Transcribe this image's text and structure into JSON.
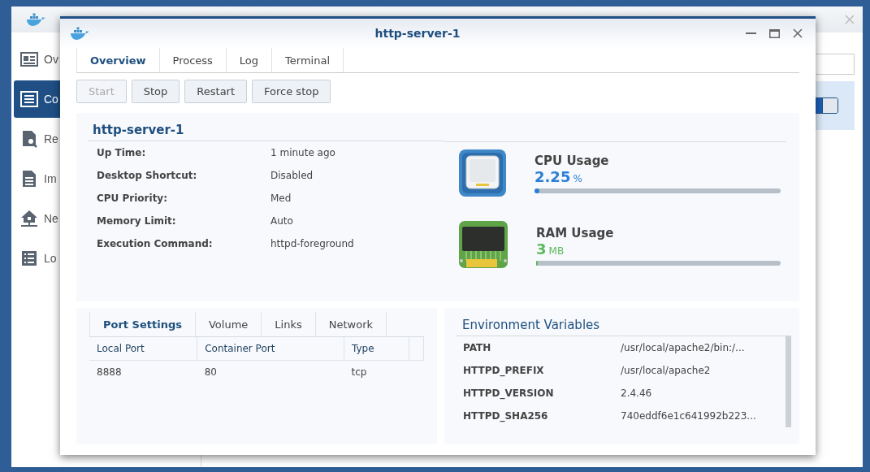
{
  "app": {
    "sidebar": [
      {
        "label": "Ov",
        "selected": false
      },
      {
        "label": "Co",
        "selected": true
      },
      {
        "label": "Re",
        "selected": false
      },
      {
        "label": "Im",
        "selected": false
      },
      {
        "label": "Ne",
        "selected": false
      },
      {
        "label": "Lo",
        "selected": false
      }
    ],
    "toggle": {
      "on": true
    }
  },
  "dialog": {
    "title": "http-server-1",
    "tabs": [
      {
        "label": "Overview",
        "selected": true
      },
      {
        "label": "Process",
        "selected": false
      },
      {
        "label": "Log",
        "selected": false
      },
      {
        "label": "Terminal",
        "selected": false
      }
    ],
    "buttons": [
      {
        "label": "Start",
        "disabled": true
      },
      {
        "label": "Stop",
        "disabled": false
      },
      {
        "label": "Restart",
        "disabled": false
      },
      {
        "label": "Force stop",
        "disabled": false
      }
    ],
    "overview": {
      "name": "http-server-1",
      "details": [
        {
          "label": "Up Time:",
          "value": "1 minute ago"
        },
        {
          "label": "Desktop Shortcut:",
          "value": "Disabled"
        },
        {
          "label": "CPU Priority:",
          "value": "Med"
        },
        {
          "label": "Memory Limit:",
          "value": "Auto"
        },
        {
          "label": "Execution Command:",
          "value": "httpd-foreground"
        }
      ]
    },
    "usage": [
      {
        "kind": "cpu",
        "title": "CPU Usage",
        "value": "2.25",
        "unit": "%",
        "level": 0.02
      },
      {
        "kind": "ram",
        "title": "RAM Usage",
        "value": "3",
        "unit": "MB",
        "level": 0.005
      }
    ],
    "settings_tabs": [
      {
        "label": "Port Settings",
        "selected": true
      },
      {
        "label": "Volume",
        "selected": false
      },
      {
        "label": "Links",
        "selected": false
      },
      {
        "label": "Network",
        "selected": false
      }
    ],
    "ports": {
      "columns": [
        "Local Port",
        "Container Port",
        "Type"
      ],
      "rows": [
        [
          "8888",
          "80",
          "tcp"
        ]
      ]
    },
    "env": {
      "title": "Environment Variables",
      "rows": [
        {
          "name": "PATH",
          "value": "/usr/local/apache2/bin:/..."
        },
        {
          "name": "HTTPD_PREFIX",
          "value": "/usr/local/apache2"
        },
        {
          "name": "HTTPD_VERSION",
          "value": "2.4.46"
        },
        {
          "name": "HTTPD_SHA256",
          "value": "740eddf6e1c641992b223..."
        }
      ]
    }
  }
}
